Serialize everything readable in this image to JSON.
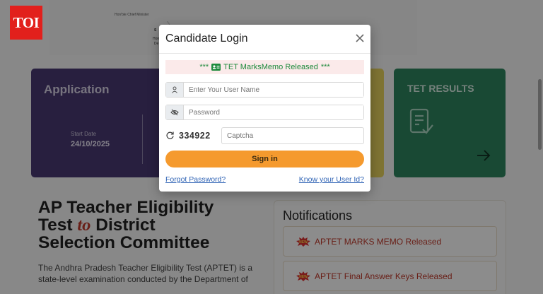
{
  "brand": {
    "logo_text": "TOI"
  },
  "banner": {
    "caption": "Hon'ble Chief Minister",
    "fragment_1": "S",
    "fragment_2": "Hon",
    "fragment_3": "De"
  },
  "cards": {
    "application": {
      "title": "Application",
      "start_label": "Start Date",
      "start_value": "24/10/2025",
      "color": "#4a3a73"
    },
    "results": {
      "title": "TET RESULTS",
      "color": "#2e8560"
    }
  },
  "headline": {
    "line1": "AP Teacher Eligibility",
    "line2_a": "Test ",
    "line2_to": "to",
    "line2_b": " District",
    "line3": "Selection Committee"
  },
  "intro": {
    "text": "The Andhra Pradesh Teacher Eligibility Test (APTET) is a state-level examination conducted by the Department of"
  },
  "notifications": {
    "title": "Notifications",
    "items": [
      {
        "text": "APTET MARKS MEMO Released"
      },
      {
        "text": "APTET Final Answer Keys Released"
      }
    ]
  },
  "modal": {
    "title": "Candidate Login",
    "banner_prefix": "***",
    "banner_text": "TET MarksMemo Released",
    "banner_suffix": "***",
    "username_placeholder": "Enter Your User Name",
    "password_placeholder": "Password",
    "captcha_code": "334922",
    "captcha_placeholder": "Captcha",
    "signin_label": "Sign in",
    "forgot_label": "Forgot Password?",
    "know_userid_label": "Know your User Id?",
    "accent_color": "#f59a2e",
    "link_color": "#2f63b5"
  }
}
